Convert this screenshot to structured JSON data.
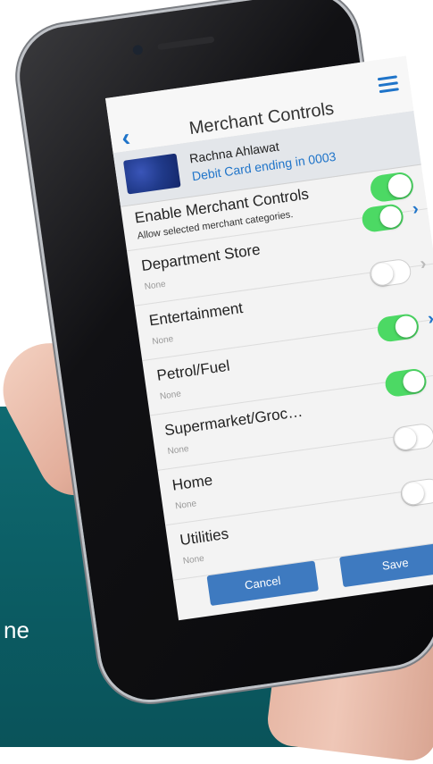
{
  "background": {
    "teal_text": "ne"
  },
  "nav": {
    "title": "Merchant Controls",
    "back_icon": "chevron-left-icon",
    "menu_icon": "hamburger-menu-icon"
  },
  "card": {
    "holder": "Rachna Ahlawat",
    "description": "Debit Card ending in 0003"
  },
  "enable": {
    "title": "Enable Merchant Controls",
    "subtitle": "Allow selected merchant categories.",
    "enabled": true
  },
  "categories": [
    {
      "label": "Department Store",
      "detail": "None",
      "enabled": true
    },
    {
      "label": "Entertainment",
      "detail": "None",
      "enabled": false
    },
    {
      "label": "Petrol/Fuel",
      "detail": "None",
      "enabled": true
    },
    {
      "label": "Supermarket/Groc…",
      "detail": "None",
      "enabled": true
    },
    {
      "label": "Home",
      "detail": "None",
      "enabled": false
    },
    {
      "label": "Utilities",
      "detail": "None",
      "enabled": false
    }
  ],
  "buttons": {
    "cancel": "Cancel",
    "save": "Save"
  },
  "colors": {
    "accent": "#1f74c9",
    "toggle_on": "#4cd964",
    "button": "#3e7ac0",
    "teal_background": "#0f6a71"
  }
}
